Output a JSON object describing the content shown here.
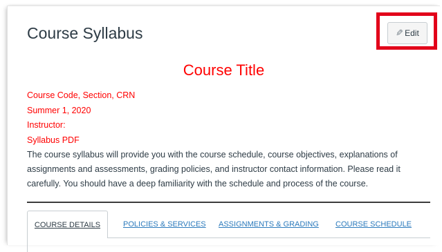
{
  "page": {
    "title": "Course Syllabus",
    "edit_label": "Edit",
    "edit_icon": "pencil-icon"
  },
  "syllabus": {
    "course_title": "Course Title",
    "meta_lines": [
      "Course Code, Section, CRN",
      "Summer 1, 2020",
      "Instructor:",
      "Syllabus PDF"
    ],
    "description": "The course syllabus will provide you with the course schedule, course objectives, explanations of assignments and assessments, grading policies, and instructor contact information. Please read it carefully. You should have a deep familiarity with the schedule and process of the course."
  },
  "tabs": [
    {
      "label": "COURSE DETAILS",
      "active": true
    },
    {
      "label": "POLICIES & SERVICES",
      "active": false
    },
    {
      "label": "ASSIGNMENTS & GRADING",
      "active": false
    },
    {
      "label": "COURSE SCHEDULE",
      "active": false
    }
  ],
  "colors": {
    "accent_red": "#ff0000",
    "highlight_box": "#e2001a",
    "link_blue": "#2b7abc",
    "text": "#2d3b45"
  }
}
